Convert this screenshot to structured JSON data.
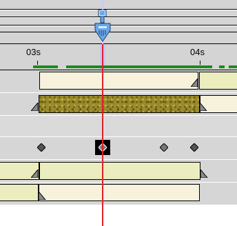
{
  "ruler": {
    "label_a": "03s",
    "label_b": "04s"
  },
  "colors": {
    "cti": "#e0202a",
    "cti_head": "#6aa7e8",
    "work_area": "#1a8c1a",
    "layer_bar": "#f7f2dc",
    "layer_bar_alt": "#ecedbf",
    "track": "#d6d6d6"
  },
  "icons": {
    "playhead": "current-time-indicator-icon",
    "keyframe": "keyframe-diamond-icon",
    "in_point": "layer-in-point-cap-icon",
    "out_point": "layer-out-point-cap-icon"
  }
}
